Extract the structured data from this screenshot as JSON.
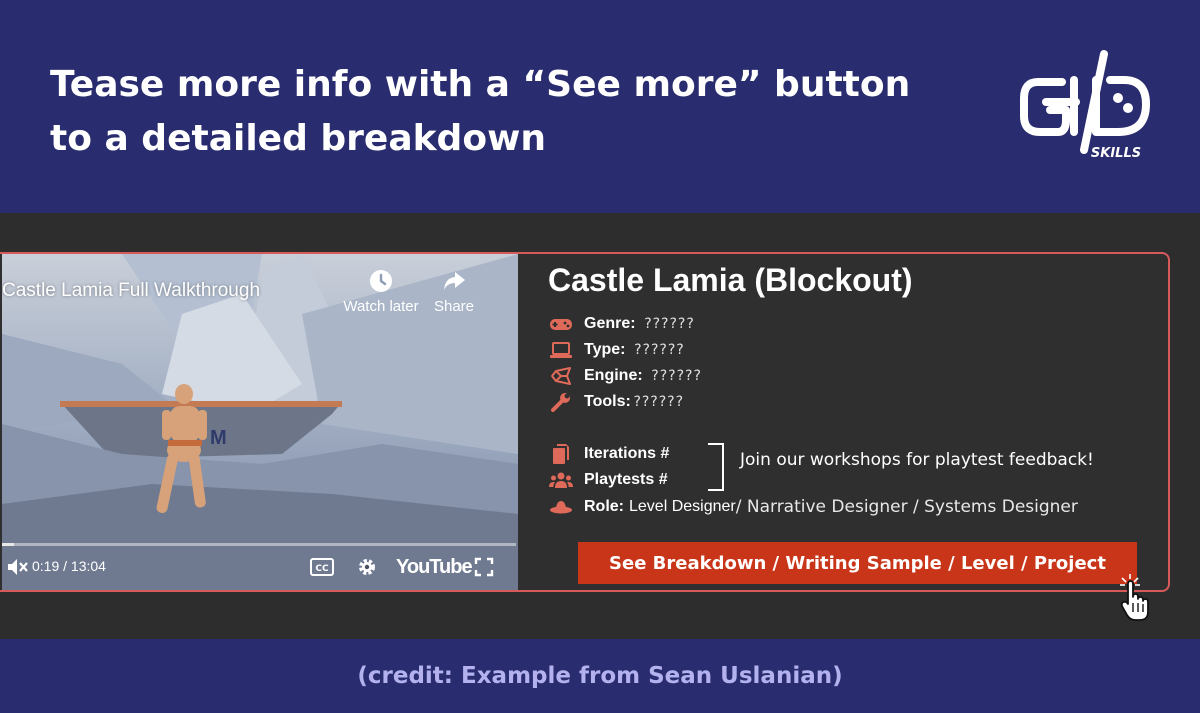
{
  "header": {
    "headline_line1": "Tease more info with a “See more” button",
    "headline_line2": "to a detailed breakdown",
    "logo_text": "SKILLS"
  },
  "video": {
    "title": "Castle Lamia Full Walkthrough",
    "watch_later_label": "Watch later",
    "share_label": "Share",
    "time": "0:19 / 13:04",
    "platform_label": "YouTube",
    "progress": 0.024
  },
  "project": {
    "title": "Castle Lamia (Blockout)",
    "fields": [
      {
        "label": "Genre:",
        "value": "??????",
        "icon": "gamepad-icon"
      },
      {
        "label": "Type:",
        "value": "??????",
        "icon": "laptop-icon"
      },
      {
        "label": "Engine:",
        "value": "??????",
        "icon": "unity-icon"
      },
      {
        "label": "Tools:",
        "value": "??????",
        "icon": "wrench-icon"
      }
    ],
    "iterations_label": "Iterations #",
    "playtests_label": "Playtests #",
    "role_label": "Role:",
    "role_value": "Level Designer",
    "role_rest": " / Narrative Designer / Systems Designer",
    "workshop_note": "Join our workshops for playtest feedback!",
    "cta_label": "See Breakdown / Writing Sample / Level / Project"
  },
  "footer": {
    "credit": "(credit: Example from Sean Uslanian)"
  },
  "colors": {
    "navy": "#292c6e",
    "card_bg": "#2f2f2f",
    "card_border": "#d65a5a",
    "accent_red": "#c93519",
    "icon_red": "#e06a5a",
    "credit_text": "#b3b2ef"
  }
}
